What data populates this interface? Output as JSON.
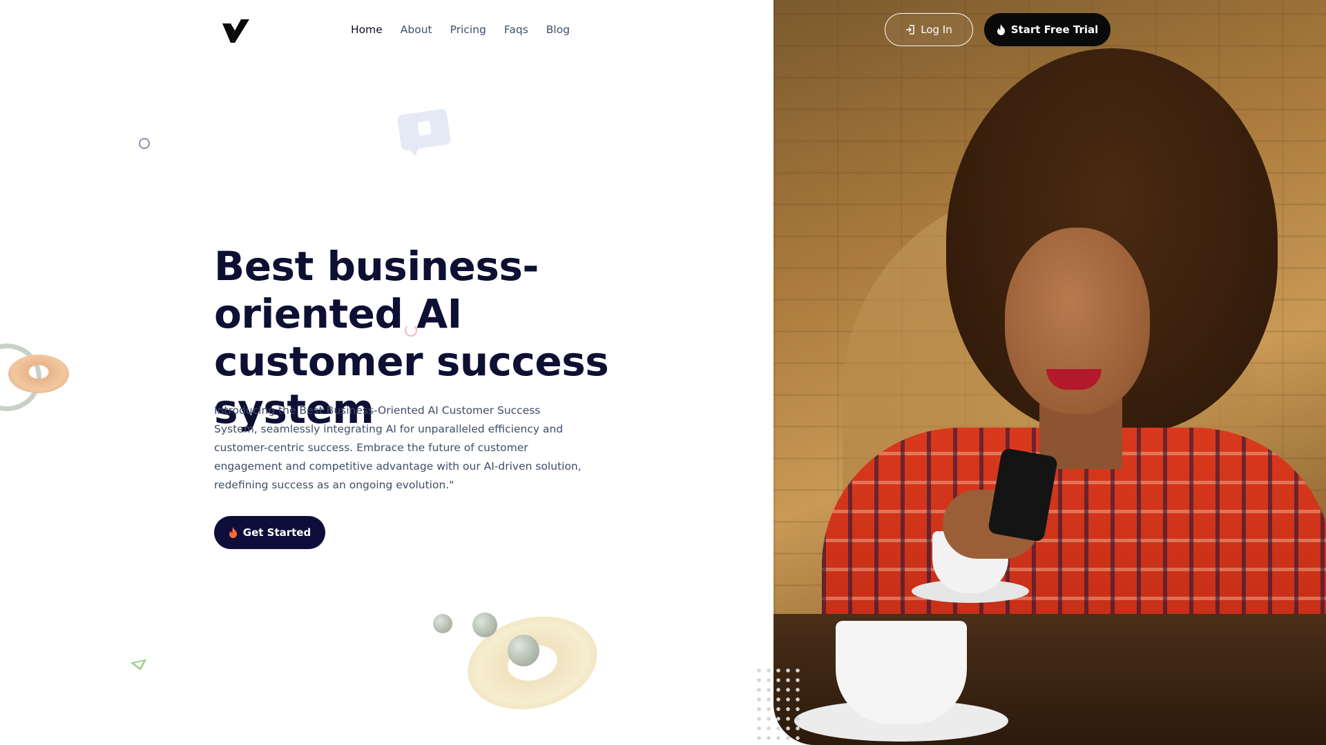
{
  "nav": {
    "items": [
      {
        "label": "Home",
        "active": true
      },
      {
        "label": "About",
        "active": false
      },
      {
        "label": "Pricing",
        "active": false
      },
      {
        "label": "Faqs",
        "active": false
      },
      {
        "label": "Blog",
        "active": false
      }
    ]
  },
  "header": {
    "login_label": "Log In",
    "login_icon": "login-icon",
    "trial_label": "Start Free Trial",
    "trial_icon": "flame-icon"
  },
  "hero": {
    "title": "Best business-oriented AI customer success system",
    "description": "Introducing the Best Business-Oriented AI Customer Success System, seamlessly integrating AI for unparalleled efficiency and customer-centric success. Embrace the future of customer engagement and competitive advantage with our AI-driven solution, redefining success as an ongoing evolution.\"",
    "cta_label": "Get Started",
    "cta_icon": "flame-icon"
  },
  "colors": {
    "primary_dark": "#0d0f3a",
    "nav_text": "#3d4f6b",
    "flame_accent": "#ff6b35"
  }
}
